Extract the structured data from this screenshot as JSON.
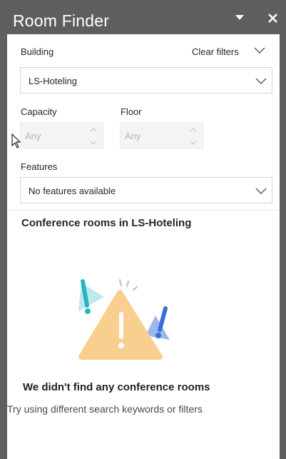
{
  "window": {
    "title": "Room Finder",
    "menu_icon": "triangle-down-icon",
    "close_icon": "close-icon"
  },
  "filters": {
    "building_label": "Building",
    "clear_filters_label": "Clear filters",
    "building_value": "LS-Hoteling",
    "capacity_label": "Capacity",
    "capacity_placeholder": "Any",
    "floor_label": "Floor",
    "floor_placeholder": "Any",
    "features_label": "Features",
    "features_value": "No features available"
  },
  "results": {
    "heading": "Conference rooms in LS-Hoteling",
    "empty_title": "We didn't find any conference rooms",
    "empty_subtitle": "Try using different search keywords or filters"
  },
  "colors": {
    "warning_triangle": "#f9cf8f",
    "teal_accent": "#28b3c5",
    "blue_accent": "#3c6ed8",
    "titlebar": "#5e5e5e"
  }
}
